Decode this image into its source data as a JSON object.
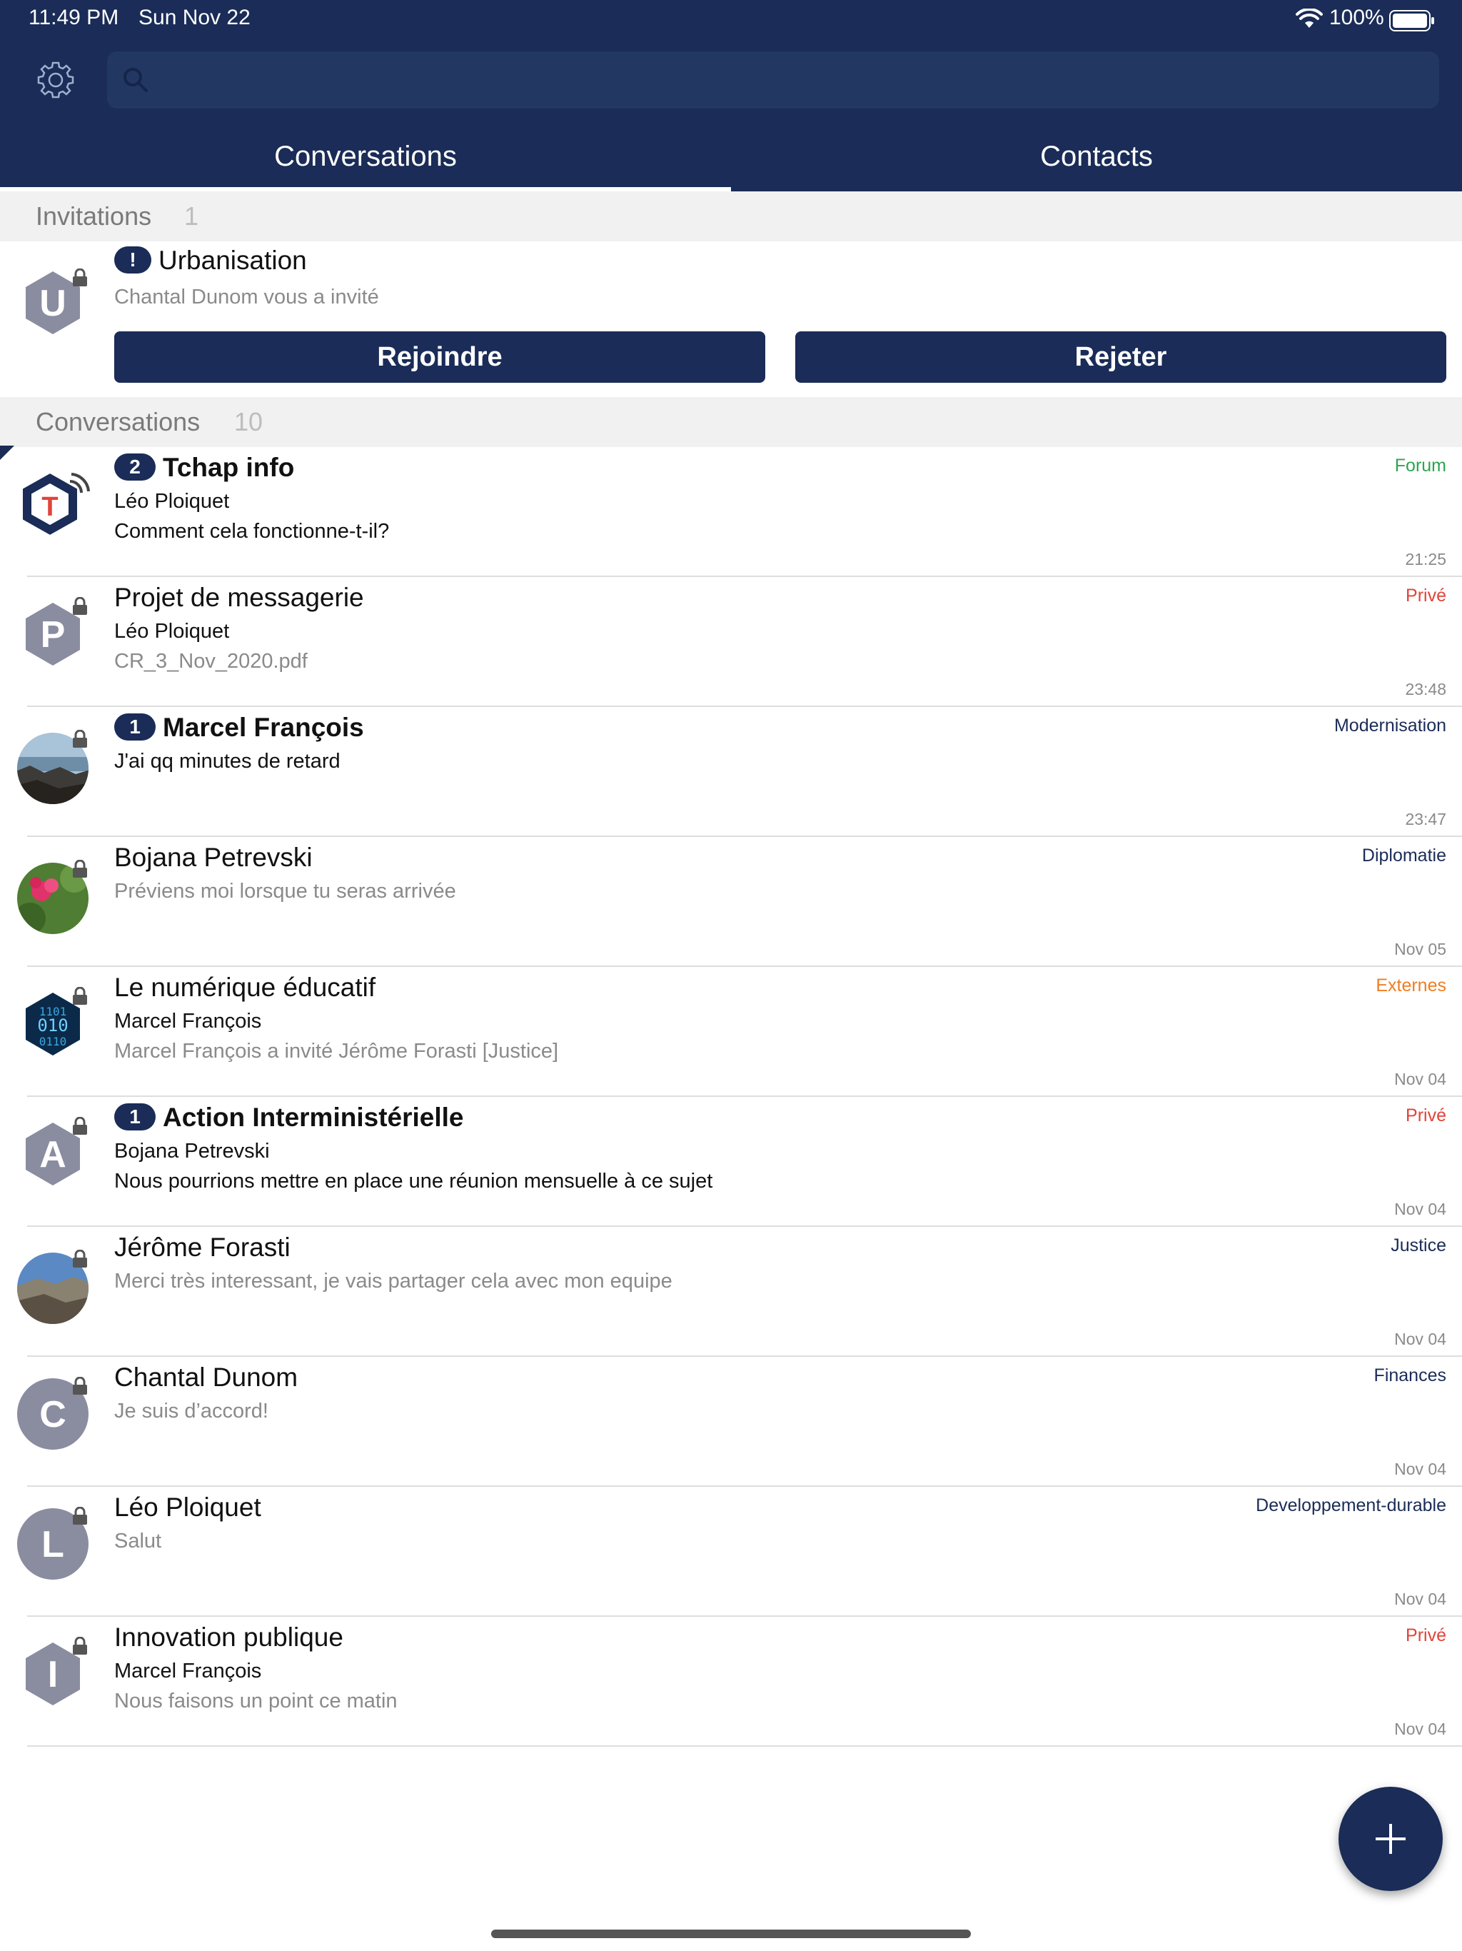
{
  "status_bar": {
    "time": "11:49 PM",
    "date": "Sun Nov 22",
    "battery": "100%"
  },
  "search": {
    "placeholder": ""
  },
  "tabs": [
    {
      "label": "Conversations",
      "selected": true
    },
    {
      "label": "Contacts",
      "selected": false
    }
  ],
  "invitations": {
    "header": "Invitations",
    "count": "1",
    "item": {
      "avatar_letter": "U",
      "badge": "!",
      "name": "Urbanisation",
      "subtitle": "Chantal Dunom vous a invité",
      "join_label": "Rejoindre",
      "reject_label": "Rejeter"
    }
  },
  "conversations": {
    "header": "Conversations",
    "count": "10",
    "items": [
      {
        "name": "Tchap info",
        "badge": "2",
        "line2": "Léo Ploiquet",
        "line3": "Comment cela fonctionne-t-il?",
        "tag": "Forum",
        "time": "21:25",
        "avatar": "tchap-logo"
      },
      {
        "name": "Projet de messagerie",
        "badge": "",
        "line2": "Léo Ploiquet",
        "line3": "CR_3_Nov_2020.pdf",
        "tag": "Privé",
        "time": "23:48",
        "avatar": "P"
      },
      {
        "name": "Marcel François",
        "badge": "1",
        "line2": "J'ai qq minutes de retard",
        "line3": "",
        "tag": "Modernisation",
        "time": "23:47",
        "avatar": "photo-rocks"
      },
      {
        "name": "Bojana Petrevski",
        "badge": "",
        "line2": "Préviens moi lorsque tu seras arrivée",
        "line3": "",
        "tag": "Diplomatie",
        "time": "Nov 05",
        "avatar": "photo-flower"
      },
      {
        "name": "Le numérique éducatif",
        "badge": "",
        "line2": "Marcel François",
        "line3": "Marcel François a invité Jérôme Forasti [Justice]",
        "tag": "Externes",
        "time": "Nov 04",
        "avatar": "binary-hex"
      },
      {
        "name": "Action Interministérielle",
        "badge": "1",
        "line2": "Bojana Petrevski",
        "line3": "Nous pourrions mettre en place une réunion mensuelle à ce sujet",
        "tag": "Privé",
        "time": "Nov 04",
        "avatar": "A"
      },
      {
        "name": "Jérôme Forasti",
        "badge": "",
        "line2": "Merci très interessant, je vais partager cela avec mon equipe",
        "line3": "",
        "tag": "Justice",
        "time": "Nov 04",
        "avatar": "photo-landscape"
      },
      {
        "name": "Chantal Dunom",
        "badge": "",
        "line2": "Je suis d’accord!",
        "line3": "",
        "tag": "Finances",
        "time": "Nov 04",
        "avatar": "C"
      },
      {
        "name": "Léo Ploiquet",
        "badge": "",
        "line2": "Salut",
        "line3": "",
        "tag": "Developpement-durable",
        "time": "Nov 04",
        "avatar": "L"
      },
      {
        "name": "Innovation publique",
        "badge": "",
        "line2": "Marcel François",
        "line3": "Nous faisons un point ce matin",
        "tag": "Privé",
        "time": "Nov 04",
        "avatar": "I"
      }
    ]
  },
  "colors": {
    "navy": "#1a2c57",
    "forum": "#2ea44f",
    "private": "#e0443a",
    "external": "#ef7d22",
    "domain": "#1a2c57",
    "avatar_grey": "#8a8ca0"
  }
}
